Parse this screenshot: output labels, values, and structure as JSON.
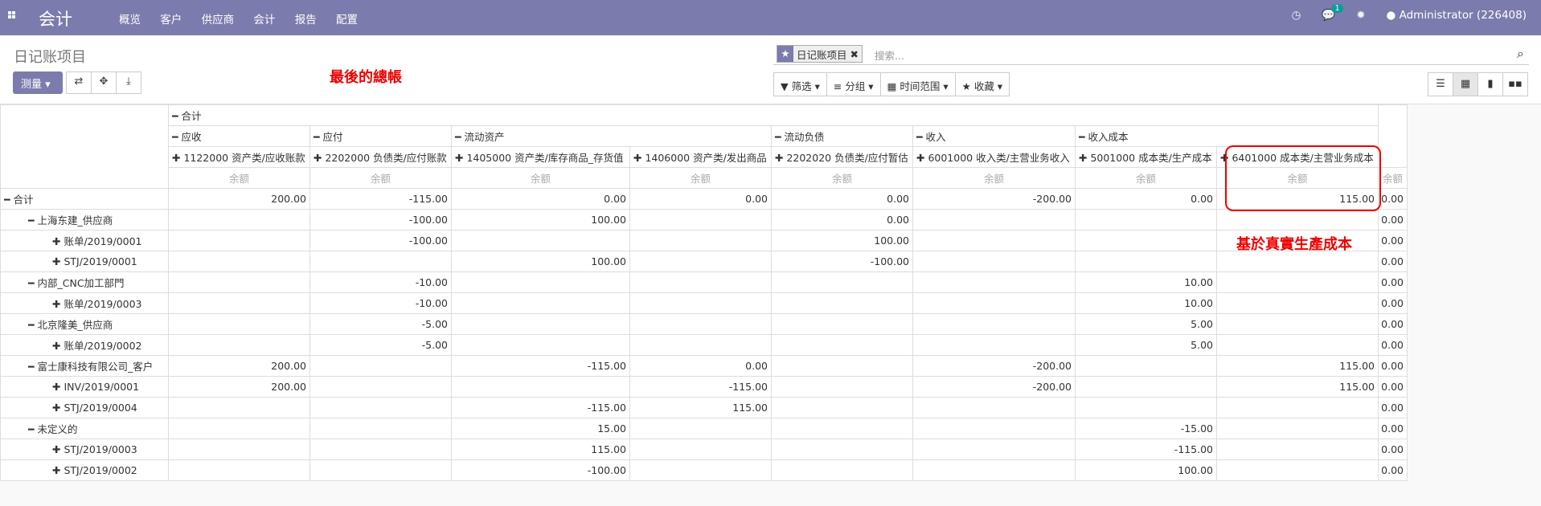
{
  "navbar": {
    "app_title": "会计",
    "menu": [
      "概览",
      "客户",
      "供应商",
      "会计",
      "报告",
      "配置"
    ],
    "chat_count": "1",
    "user": "Administrator (226408)",
    "bg_color": "#7c7bad"
  },
  "page": {
    "breadcrumb": "日记账项目",
    "measures_label": "测量 ▾",
    "note_total": "最後的總帳",
    "note_cost": "基於真實生產成本"
  },
  "search": {
    "facet_label": "日记账项目",
    "placeholder": "搜索..."
  },
  "filters": {
    "filter": "筛选 ▾",
    "group": "分组 ▾",
    "time": "时间范围 ▾",
    "fav": "收藏 ▾"
  },
  "pivot": {
    "total_label": "合计",
    "groups": [
      "应收",
      "应付",
      "流动资产",
      "流动负债",
      "收入",
      "收入成本"
    ],
    "accounts": [
      "1122000 资产类/应收账款",
      "2202000 负债类/应付账款",
      "1405000 资产类/库存商品_存货值",
      "1406000 资产类/发出商品",
      "2202020 负债类/应付暂估",
      "6001000 收入类/主营业务收入",
      "5001000 成本类/生产成本",
      "6401000 成本类/主营业务成本"
    ],
    "measure": "余额",
    "rows": [
      {
        "label": "合计",
        "values": [
          "200.00",
          "-115.00",
          "0.00",
          "0.00",
          "0.00",
          "-200.00",
          "0.00",
          "115.00"
        ],
        "total": "0.00"
      },
      {
        "label": "上海东建_供应商",
        "values": [
          "",
          "-100.00",
          "100.00",
          "",
          "0.00",
          "",
          "",
          ""
        ],
        "total": "0.00"
      },
      {
        "label": "账单/2019/0001",
        "values": [
          "",
          "-100.00",
          "",
          "",
          "100.00",
          "",
          "",
          ""
        ],
        "total": "0.00"
      },
      {
        "label": "STJ/2019/0001",
        "values": [
          "",
          "",
          "100.00",
          "",
          "-100.00",
          "",
          "",
          ""
        ],
        "total": "0.00"
      },
      {
        "label": "内部_CNC加工部門",
        "values": [
          "",
          "-10.00",
          "",
          "",
          "",
          "",
          "10.00",
          ""
        ],
        "total": "0.00"
      },
      {
        "label": "账单/2019/0003",
        "values": [
          "",
          "-10.00",
          "",
          "",
          "",
          "",
          "10.00",
          ""
        ],
        "total": "0.00"
      },
      {
        "label": "北京隆美_供应商",
        "values": [
          "",
          "-5.00",
          "",
          "",
          "",
          "",
          "5.00",
          ""
        ],
        "total": "0.00"
      },
      {
        "label": "账单/2019/0002",
        "values": [
          "",
          "-5.00",
          "",
          "",
          "",
          "",
          "5.00",
          ""
        ],
        "total": "0.00"
      },
      {
        "label": "富士康科技有限公司_客户",
        "values": [
          "200.00",
          "",
          "-115.00",
          "0.00",
          "",
          "-200.00",
          "",
          "115.00"
        ],
        "total": "0.00"
      },
      {
        "label": "INV/2019/0001",
        "values": [
          "200.00",
          "",
          "",
          "-115.00",
          "",
          "-200.00",
          "",
          "115.00"
        ],
        "total": "0.00"
      },
      {
        "label": "STJ/2019/0004",
        "values": [
          "",
          "",
          "-115.00",
          "115.00",
          "",
          "",
          "",
          ""
        ],
        "total": "0.00"
      },
      {
        "label": "未定义的",
        "values": [
          "",
          "",
          "15.00",
          "",
          "",
          "",
          "-15.00",
          ""
        ],
        "total": "0.00"
      },
      {
        "label": "STJ/2019/0003",
        "values": [
          "",
          "",
          "115.00",
          "",
          "",
          "",
          "-115.00",
          ""
        ],
        "total": "0.00"
      },
      {
        "label": "STJ/2019/0002",
        "values": [
          "",
          "",
          "-100.00",
          "",
          "",
          "",
          "100.00",
          ""
        ],
        "total": "0.00"
      }
    ]
  }
}
